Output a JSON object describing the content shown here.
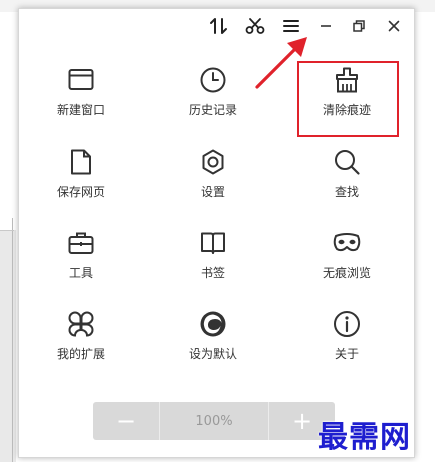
{
  "menu": {
    "items": [
      {
        "label": "新建窗口",
        "icon": "new-window-icon"
      },
      {
        "label": "历史记录",
        "icon": "history-clock-icon"
      },
      {
        "label": "清除痕迹",
        "icon": "broom-icon"
      },
      {
        "label": "保存网页",
        "icon": "save-page-icon"
      },
      {
        "label": "设置",
        "icon": "settings-gear-icon"
      },
      {
        "label": "查找",
        "icon": "search-icon"
      },
      {
        "label": "工具",
        "icon": "toolbox-icon"
      },
      {
        "label": "书签",
        "icon": "bookmark-book-icon"
      },
      {
        "label": "无痕浏览",
        "icon": "incognito-mask-icon"
      },
      {
        "label": "我的扩展",
        "icon": "extensions-icon"
      },
      {
        "label": "设为默认",
        "icon": "set-default-icon"
      },
      {
        "label": "关于",
        "icon": "info-icon"
      }
    ]
  },
  "zoom": {
    "minus_label": "−",
    "value": "100%",
    "plus_label": "+"
  },
  "watermark": {
    "text": "最需网"
  },
  "colors": {
    "highlight": "#e0222b",
    "icon": "#333333",
    "watermark": "#1e1ecf"
  }
}
